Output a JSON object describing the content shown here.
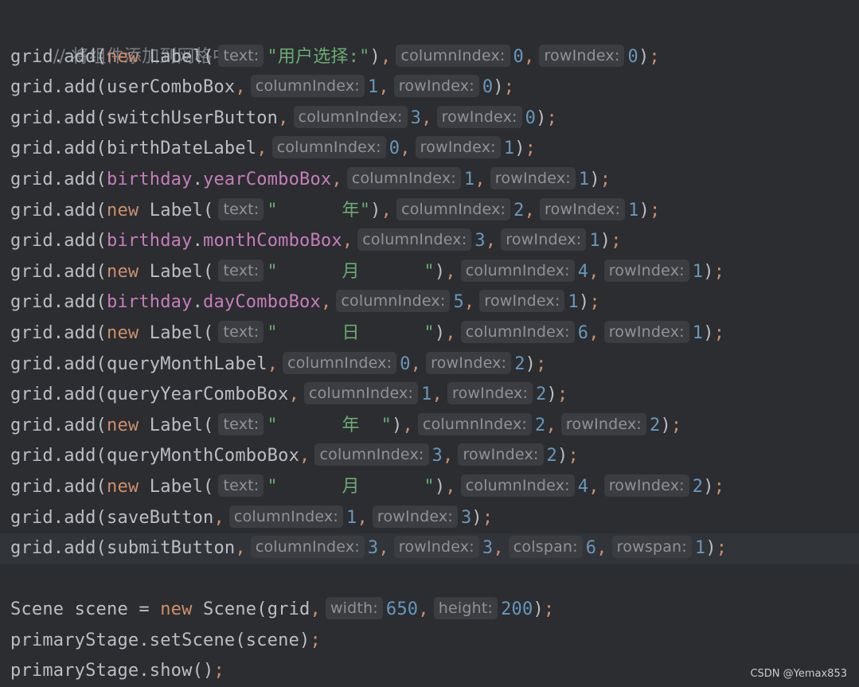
{
  "comment": "// 将组件添加到网格中",
  "watermark": "CSDN @Yemax853",
  "colors": {
    "background": "#2b2d30",
    "keyword": "#cf8e6d",
    "string": "#6aab73",
    "number": "#6897bb",
    "field": "#c77dbb",
    "hint_bg": "#3b3d41",
    "current_line": "#313438"
  },
  "lines": [
    [
      [
        "t",
        "grid.add("
      ],
      [
        "k",
        "new"
      ],
      [
        "t",
        " Label("
      ],
      [
        "h",
        "text:"
      ],
      [
        "s",
        "\"用户选择:\""
      ],
      [
        "t",
        ")"
      ],
      [
        "c",
        ","
      ],
      [
        "h",
        "columnIndex:"
      ],
      [
        "n",
        "0"
      ],
      [
        "c",
        ","
      ],
      [
        "h",
        "rowIndex:"
      ],
      [
        "n",
        "0"
      ],
      [
        "t",
        ")"
      ],
      [
        "c",
        ";"
      ]
    ],
    [
      [
        "t",
        "grid.add(userComboBox"
      ],
      [
        "c",
        ","
      ],
      [
        "h",
        "columnIndex:"
      ],
      [
        "n",
        "1"
      ],
      [
        "c",
        ","
      ],
      [
        "h",
        "rowIndex:"
      ],
      [
        "n",
        "0"
      ],
      [
        "t",
        ")"
      ],
      [
        "c",
        ";"
      ]
    ],
    [
      [
        "t",
        "grid.add(switchUserButton"
      ],
      [
        "c",
        ","
      ],
      [
        "h",
        "columnIndex:"
      ],
      [
        "n",
        "3"
      ],
      [
        "c",
        ","
      ],
      [
        "h",
        "rowIndex:"
      ],
      [
        "n",
        "0"
      ],
      [
        "t",
        ")"
      ],
      [
        "c",
        ";"
      ]
    ],
    [
      [
        "t",
        "grid.add(birthDateLabel"
      ],
      [
        "c",
        ","
      ],
      [
        "h",
        "columnIndex:"
      ],
      [
        "n",
        "0"
      ],
      [
        "c",
        ","
      ],
      [
        "h",
        "rowIndex:"
      ],
      [
        "n",
        "1"
      ],
      [
        "t",
        ")"
      ],
      [
        "c",
        ";"
      ]
    ],
    [
      [
        "t",
        "grid.add("
      ],
      [
        "f",
        "birthday"
      ],
      [
        "t",
        "."
      ],
      [
        "f",
        "yearComboBox"
      ],
      [
        "c",
        ","
      ],
      [
        "h",
        "columnIndex:"
      ],
      [
        "n",
        "1"
      ],
      [
        "c",
        ","
      ],
      [
        "h",
        "rowIndex:"
      ],
      [
        "n",
        "1"
      ],
      [
        "t",
        ")"
      ],
      [
        "c",
        ";"
      ]
    ],
    [
      [
        "t",
        "grid.add("
      ],
      [
        "k",
        "new"
      ],
      [
        "t",
        " Label("
      ],
      [
        "h",
        "text:"
      ],
      [
        "s",
        "\"      年\""
      ],
      [
        "t",
        ")"
      ],
      [
        "c",
        ","
      ],
      [
        "h",
        "columnIndex:"
      ],
      [
        "n",
        "2"
      ],
      [
        "c",
        ","
      ],
      [
        "h",
        "rowIndex:"
      ],
      [
        "n",
        "1"
      ],
      [
        "t",
        ")"
      ],
      [
        "c",
        ";"
      ]
    ],
    [
      [
        "t",
        "grid.add("
      ],
      [
        "f",
        "birthday"
      ],
      [
        "t",
        "."
      ],
      [
        "f",
        "monthComboBox"
      ],
      [
        "c",
        ","
      ],
      [
        "h",
        "columnIndex:"
      ],
      [
        "n",
        "3"
      ],
      [
        "c",
        ","
      ],
      [
        "h",
        "rowIndex:"
      ],
      [
        "n",
        "1"
      ],
      [
        "t",
        ")"
      ],
      [
        "c",
        ";"
      ]
    ],
    [
      [
        "t",
        "grid.add("
      ],
      [
        "k",
        "new"
      ],
      [
        "t",
        " Label("
      ],
      [
        "h",
        "text:"
      ],
      [
        "s",
        "\"      月      \""
      ],
      [
        "t",
        ")"
      ],
      [
        "c",
        ","
      ],
      [
        "h",
        "columnIndex:"
      ],
      [
        "n",
        "4"
      ],
      [
        "c",
        ","
      ],
      [
        "h",
        "rowIndex:"
      ],
      [
        "n",
        "1"
      ],
      [
        "t",
        ")"
      ],
      [
        "c",
        ";"
      ]
    ],
    [
      [
        "t",
        "grid.add("
      ],
      [
        "f",
        "birthday"
      ],
      [
        "t",
        "."
      ],
      [
        "f",
        "dayComboBox"
      ],
      [
        "c",
        ","
      ],
      [
        "h",
        "columnIndex:"
      ],
      [
        "n",
        "5"
      ],
      [
        "c",
        ","
      ],
      [
        "h",
        "rowIndex:"
      ],
      [
        "n",
        "1"
      ],
      [
        "t",
        ")"
      ],
      [
        "c",
        ";"
      ]
    ],
    [
      [
        "t",
        "grid.add("
      ],
      [
        "k",
        "new"
      ],
      [
        "t",
        " Label("
      ],
      [
        "h",
        "text:"
      ],
      [
        "s",
        "\"      日      \""
      ],
      [
        "t",
        ")"
      ],
      [
        "c",
        ","
      ],
      [
        "h",
        "columnIndex:"
      ],
      [
        "n",
        "6"
      ],
      [
        "c",
        ","
      ],
      [
        "h",
        "rowIndex:"
      ],
      [
        "n",
        "1"
      ],
      [
        "t",
        ")"
      ],
      [
        "c",
        ";"
      ]
    ],
    [
      [
        "t",
        "grid.add(queryMonthLabel"
      ],
      [
        "c",
        ","
      ],
      [
        "h",
        "columnIndex:"
      ],
      [
        "n",
        "0"
      ],
      [
        "c",
        ","
      ],
      [
        "h",
        "rowIndex:"
      ],
      [
        "n",
        "2"
      ],
      [
        "t",
        ")"
      ],
      [
        "c",
        ";"
      ]
    ],
    [
      [
        "t",
        "grid.add(queryYearComboBox"
      ],
      [
        "c",
        ","
      ],
      [
        "h",
        "columnIndex:"
      ],
      [
        "n",
        "1"
      ],
      [
        "c",
        ","
      ],
      [
        "h",
        "rowIndex:"
      ],
      [
        "n",
        "2"
      ],
      [
        "t",
        ")"
      ],
      [
        "c",
        ";"
      ]
    ],
    [
      [
        "t",
        "grid.add("
      ],
      [
        "k",
        "new"
      ],
      [
        "t",
        " Label("
      ],
      [
        "h",
        "text:"
      ],
      [
        "s",
        "\"      年  \""
      ],
      [
        "t",
        ")"
      ],
      [
        "c",
        ","
      ],
      [
        "h",
        "columnIndex:"
      ],
      [
        "n",
        "2"
      ],
      [
        "c",
        ","
      ],
      [
        "h",
        "rowIndex:"
      ],
      [
        "n",
        "2"
      ],
      [
        "t",
        ")"
      ],
      [
        "c",
        ";"
      ]
    ],
    [
      [
        "t",
        "grid.add(queryMonthComboBox"
      ],
      [
        "c",
        ","
      ],
      [
        "h",
        "columnIndex:"
      ],
      [
        "n",
        "3"
      ],
      [
        "c",
        ","
      ],
      [
        "h",
        "rowIndex:"
      ],
      [
        "n",
        "2"
      ],
      [
        "t",
        ")"
      ],
      [
        "c",
        ";"
      ]
    ],
    [
      [
        "t",
        "grid.add("
      ],
      [
        "k",
        "new"
      ],
      [
        "t",
        " Label("
      ],
      [
        "h",
        "text:"
      ],
      [
        "s",
        "\"      月      \""
      ],
      [
        "t",
        ")"
      ],
      [
        "c",
        ","
      ],
      [
        "h",
        "columnIndex:"
      ],
      [
        "n",
        "4"
      ],
      [
        "c",
        ","
      ],
      [
        "h",
        "rowIndex:"
      ],
      [
        "n",
        "2"
      ],
      [
        "t",
        ")"
      ],
      [
        "c",
        ";"
      ]
    ],
    [
      [
        "t",
        "grid.add(saveButton"
      ],
      [
        "c",
        ","
      ],
      [
        "h",
        "columnIndex:"
      ],
      [
        "n",
        "1"
      ],
      [
        "c",
        ","
      ],
      [
        "h",
        "rowIndex:"
      ],
      [
        "n",
        "3"
      ],
      [
        "t",
        ")"
      ],
      [
        "c",
        ";"
      ]
    ],
    [
      [
        "t",
        "grid.add(submitButton"
      ],
      [
        "c",
        ","
      ],
      [
        "h",
        "columnIndex:"
      ],
      [
        "n",
        "3"
      ],
      [
        "c",
        ","
      ],
      [
        "h",
        "rowIndex:"
      ],
      [
        "n",
        "3"
      ],
      [
        "c",
        ","
      ],
      [
        "h",
        "colspan:"
      ],
      [
        "n",
        "6"
      ],
      [
        "c",
        ","
      ],
      [
        "h",
        "rowspan:"
      ],
      [
        "n",
        "1"
      ],
      [
        "t",
        ")"
      ],
      [
        "c",
        ";"
      ]
    ],
    [],
    [
      [
        "t",
        "Scene scene = "
      ],
      [
        "k",
        "new"
      ],
      [
        "t",
        " Scene(grid"
      ],
      [
        "c",
        ","
      ],
      [
        "h",
        "width:"
      ],
      [
        "n",
        "650"
      ],
      [
        "c",
        ","
      ],
      [
        "h",
        "height:"
      ],
      [
        "n",
        "200"
      ],
      [
        "t",
        ")"
      ],
      [
        "c",
        ";"
      ]
    ],
    [
      [
        "t",
        "primaryStage.setScene(scene)"
      ],
      [
        "c",
        ";"
      ]
    ],
    [
      [
        "t",
        "primaryStage.show()"
      ],
      [
        "c",
        ";"
      ]
    ]
  ],
  "current_line": 16
}
